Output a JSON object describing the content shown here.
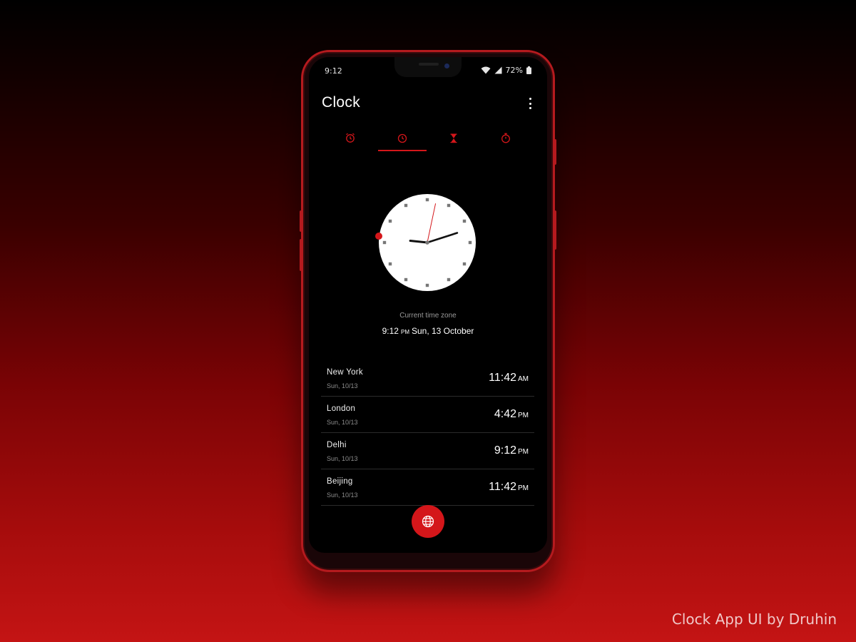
{
  "status_bar": {
    "time": "9:12",
    "battery": "72%"
  },
  "header": {
    "title": "Clock"
  },
  "tabs": [
    {
      "name": "tab-alarm",
      "icon": "alarm-icon"
    },
    {
      "name": "tab-clock",
      "icon": "clock-icon",
      "active": true
    },
    {
      "name": "tab-timer",
      "icon": "hourglass-icon"
    },
    {
      "name": "tab-stopwatch",
      "icon": "stopwatch-icon"
    }
  ],
  "analog_clock": {
    "hour": 9,
    "minute": 12,
    "second": 2
  },
  "current": {
    "caption": "Current time zone",
    "time": "9:12",
    "ampm": "PM",
    "date": "Sun, 13 October"
  },
  "world_clocks": [
    {
      "city": "New York",
      "date": "Sun, 10/13",
      "time": "11:42",
      "ampm": "AM"
    },
    {
      "city": "London",
      "date": "Sun, 10/13",
      "time": "4:42",
      "ampm": "PM"
    },
    {
      "city": "Delhi",
      "date": "Sun, 10/13",
      "time": "9:12",
      "ampm": "PM"
    },
    {
      "city": "Beijing",
      "date": "Sun, 10/13",
      "time": "11:42",
      "ampm": "PM"
    }
  ],
  "fab": {
    "icon": "globe-icon"
  },
  "colors": {
    "accent": "#d4161a",
    "background": "#000000"
  },
  "credit": "Clock App UI by Druhin"
}
